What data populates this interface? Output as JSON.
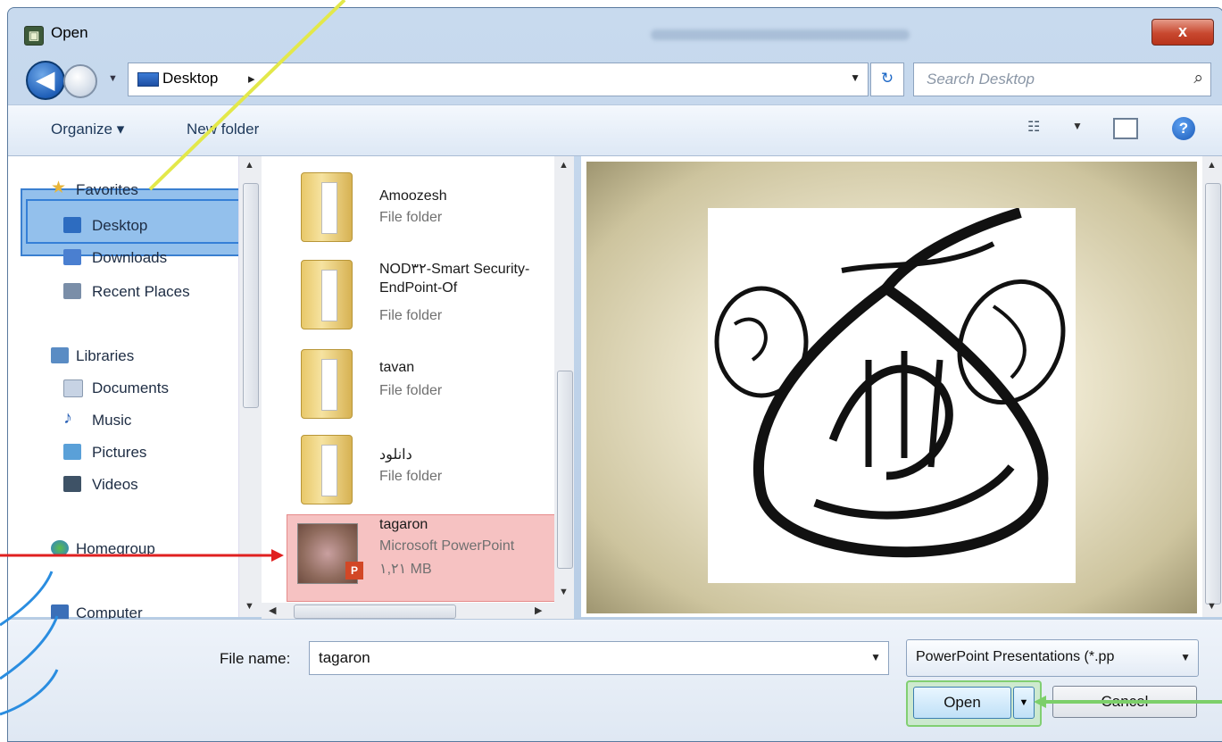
{
  "window": {
    "title": "Open",
    "close_label": "x"
  },
  "address_bar": {
    "location": "Desktop",
    "separator": "▸",
    "search_placeholder": "Search Desktop"
  },
  "toolbar": {
    "organize": "Organize ▾",
    "new_folder": "New folder"
  },
  "nav_pane": {
    "favorites": "Favorites",
    "items": [
      {
        "label": "Desktop",
        "color": "#2d6cc0"
      },
      {
        "label": "Downloads",
        "color": "#4a7fd0"
      },
      {
        "label": "Recent Places",
        "color": "#7a8ea8"
      }
    ],
    "libraries": "Libraries",
    "library_items": [
      {
        "label": "Documents",
        "color": "#c7d3e4"
      },
      {
        "label": "Music",
        "color": "#2f65b8"
      },
      {
        "label": "Pictures",
        "color": "#5aa0d8"
      },
      {
        "label": "Videos",
        "color": "#3e5266"
      }
    ],
    "homegroup": "Homegroup",
    "computer": "Computer"
  },
  "files": [
    {
      "name": "Amoozesh",
      "type": "File folder"
    },
    {
      "name": "NOD۳۲-Smart Security-EndPoint-Of",
      "type": "File folder"
    },
    {
      "name": "tavan",
      "type": "File folder"
    },
    {
      "name": "دانلود",
      "type": "File folder"
    },
    {
      "name": "tagaron",
      "type": "Microsoft PowerPoint",
      "size": "۱,۲۱ MB"
    }
  ],
  "footer": {
    "file_name_label": "File name:",
    "file_name_value": "tagaron",
    "file_type": "PowerPoint Presentations (*.pp",
    "open_label": "Open",
    "cancel_label": "Cancel"
  },
  "colors": {
    "selection": "#eb7878",
    "highlight": "#3b8cdc",
    "accent_green": "#6ec85a"
  }
}
